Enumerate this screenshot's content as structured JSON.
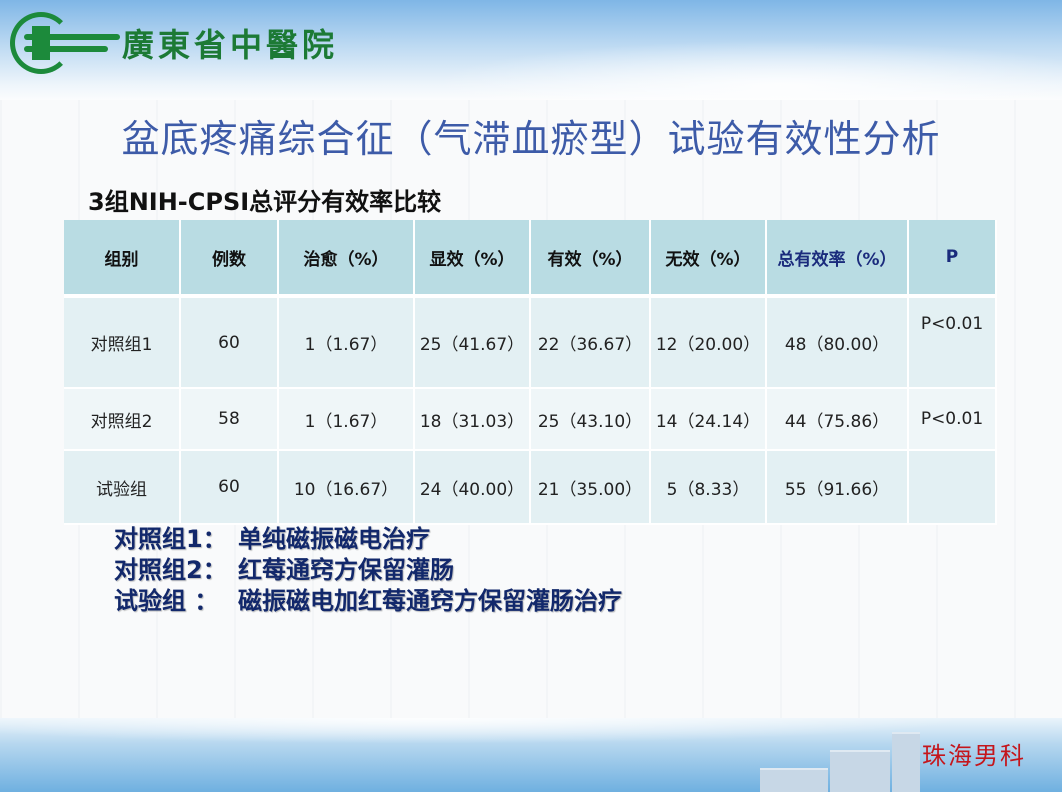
{
  "header": {
    "logo_text": "廣東省中醫院",
    "logo_icon": "hospital-cross-logo-icon"
  },
  "title": "盆底疼痛综合征（气滞血瘀型）试验有效性分析",
  "subtitle": "3组NIH-CPSI总评分有效率比较",
  "table": {
    "headers": [
      "组别",
      "例数",
      "治愈（%）",
      "显效（%）",
      "有效（%）",
      "无效（%）",
      "总有效率（%）",
      "P"
    ],
    "rows": [
      [
        "对照组1",
        "60",
        "1（1.67）",
        "25（41.67）",
        "22（36.67）",
        "12（20.00）",
        "48（80.00）",
        "P<0.01"
      ],
      [
        "对照组2",
        "58",
        "1（1.67）",
        "18（31.03）",
        "25（43.10）",
        "14（24.14）",
        "44（75.86）",
        "P<0.01"
      ],
      [
        "试验组",
        "60",
        "10（16.67）",
        "24（40.00）",
        "21（35.00）",
        "5（8.33）",
        "55（91.66）",
        ""
      ]
    ]
  },
  "notes": [
    {
      "label": "对照组1：",
      "text": "单纯磁振磁电治疗"
    },
    {
      "label": "对照组2：",
      "text": "红莓通窍方保留灌肠"
    },
    {
      "label": "试验组 ：",
      "text": "磁振磁电加红莓通窍方保留灌肠治疗"
    }
  ],
  "footer": {
    "brand": "珠海男科"
  },
  "colors": {
    "title": "#3d5ba8",
    "header_cell": "#b9dce3",
    "row_cell": "#e3f0f3",
    "notes": "#12286b",
    "brand": "#c4161c",
    "logo": "#1c8a3b"
  }
}
